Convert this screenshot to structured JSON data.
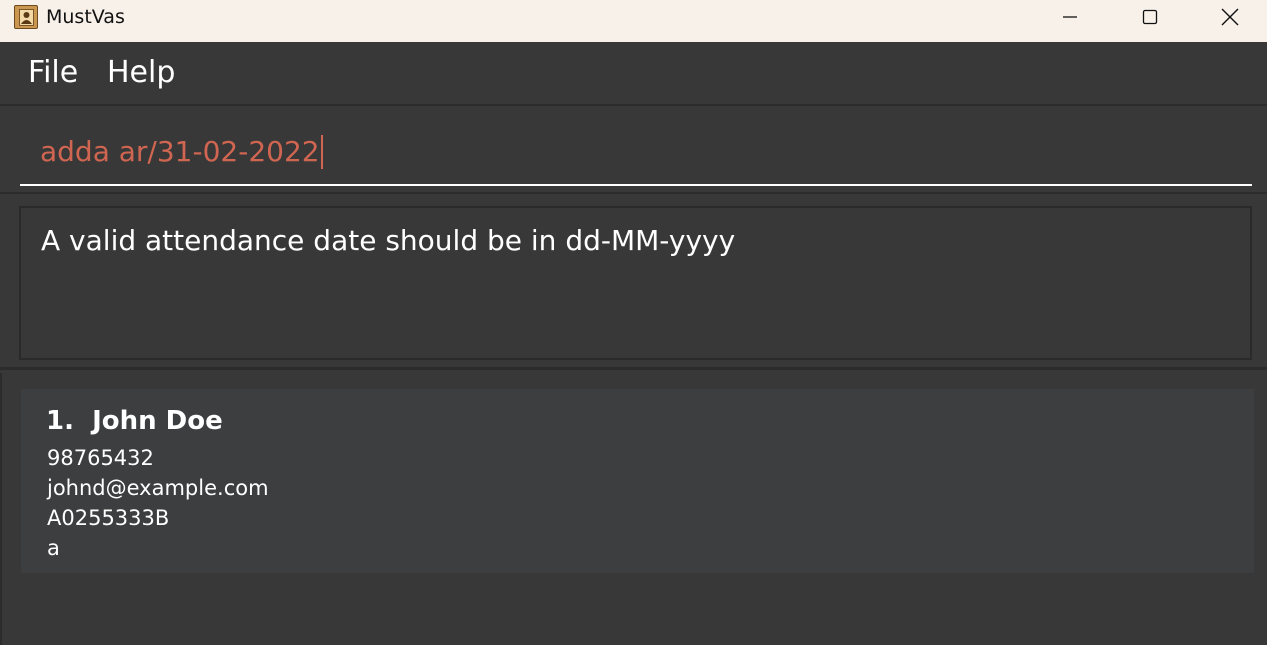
{
  "window": {
    "title": "MustVas",
    "controls": {
      "minimize_icon": "minimize-icon",
      "maximize_icon": "maximize-icon",
      "close_icon": "close-icon"
    }
  },
  "menu": {
    "items": [
      {
        "label": "File"
      },
      {
        "label": "Help"
      }
    ]
  },
  "command": {
    "value": "adda ar/31-02-2022",
    "text_color": "#d06651"
  },
  "result": {
    "message": "A valid attendance date should be in dd-MM-yyyy"
  },
  "persons": [
    {
      "index": "1.",
      "name": "John Doe",
      "phone": "98765432",
      "email": "johnd@example.com",
      "student_id": "A0255333B",
      "tag": "a"
    }
  ],
  "colors": {
    "background": "#383838",
    "titlebar": "#f7f1ea",
    "card": "#3c3e3f",
    "error_text": "#d06651"
  }
}
